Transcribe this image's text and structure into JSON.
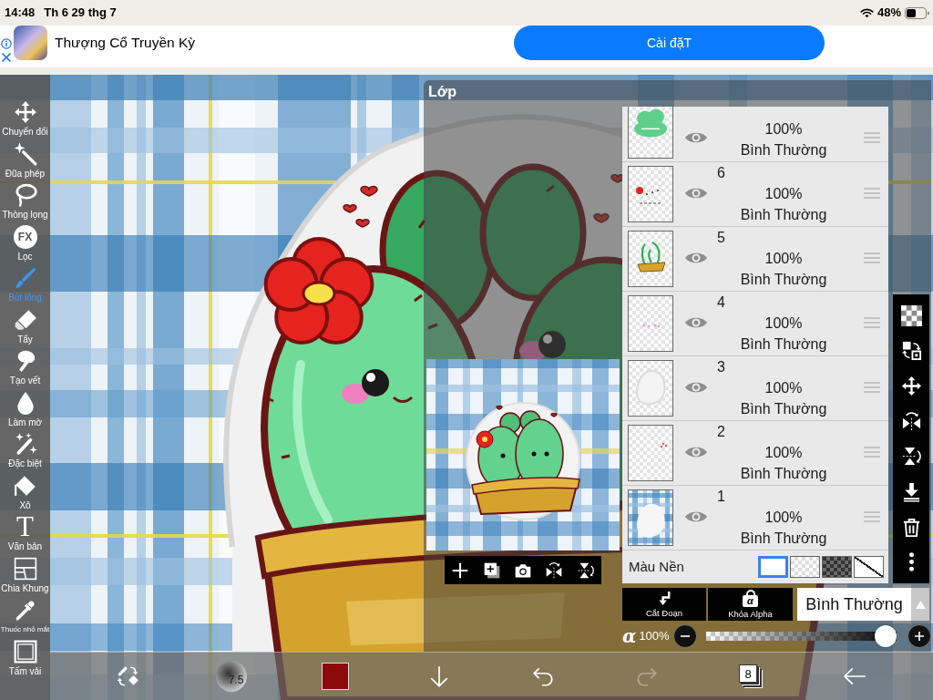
{
  "status_bar": {
    "time": "14:48",
    "date": "Th 6 29 thg 7",
    "battery": "48%"
  },
  "ad_banner": {
    "app_name": "Thượng Cổ Truyền Kỳ",
    "button": "Cài đặT"
  },
  "tools": [
    {
      "label": "Chuyển đổi",
      "selected": false
    },
    {
      "label": "Đũa phép",
      "selected": false
    },
    {
      "label": "Thòng lọng",
      "selected": false
    },
    {
      "label": "Lọc",
      "icon_text": "FX",
      "selected": false
    },
    {
      "label": "Bút lông",
      "selected": true
    },
    {
      "label": "Tẩy",
      "selected": false
    },
    {
      "label": "Tạo vết",
      "selected": false
    },
    {
      "label": "Làm mờ",
      "selected": false
    },
    {
      "label": "Đặc biệt",
      "selected": false
    },
    {
      "label": "Xô",
      "selected": false
    },
    {
      "label": "Văn bản",
      "icon_text": "T",
      "selected": false
    },
    {
      "label": "Chia Khung",
      "selected": false
    },
    {
      "label": "Thuốc nhỏ mắt",
      "selected": false
    },
    {
      "label": "Tấm vải",
      "selected": false
    }
  ],
  "layer_panel": {
    "title": "Lớp",
    "layers": [
      {
        "opacity": "100%",
        "blend": "Bình Thường",
        "visible": true
      },
      {
        "number": "6",
        "opacity": "100%",
        "blend": "Bình Thường",
        "visible": true
      },
      {
        "number": "5",
        "opacity": "100%",
        "blend": "Bình Thường",
        "visible": true
      },
      {
        "number": "4",
        "opacity": "100%",
        "blend": "Bình Thường",
        "visible": true
      },
      {
        "number": "3",
        "opacity": "100%",
        "blend": "Bình Thường",
        "visible": true
      },
      {
        "number": "2",
        "opacity": "100%",
        "blend": "Bình Thường",
        "visible": true
      },
      {
        "number": "1",
        "opacity": "100%",
        "blend": "Bình Thường",
        "visible": true
      }
    ],
    "background": {
      "label": "Màu Nền",
      "swatches": [
        {
          "kind": "white",
          "selected": true
        },
        {
          "kind": "transparent",
          "selected": false
        },
        {
          "kind": "dark",
          "selected": false
        },
        {
          "kind": "none",
          "selected": false
        }
      ]
    },
    "clipping_button": "Cắt Đoạn",
    "alpha_lock": {
      "label": "Khóa Alpha",
      "icon_text": "α"
    },
    "blend_mode": "Bình Thường",
    "opacity": {
      "symbol": "α",
      "reading": "100%",
      "level": 1
    }
  },
  "bottom_bar": {
    "brush_size": "7.5",
    "color": "#8c0a0a",
    "undo_disabled": false,
    "redo_disabled": true,
    "layer_count": "8"
  }
}
